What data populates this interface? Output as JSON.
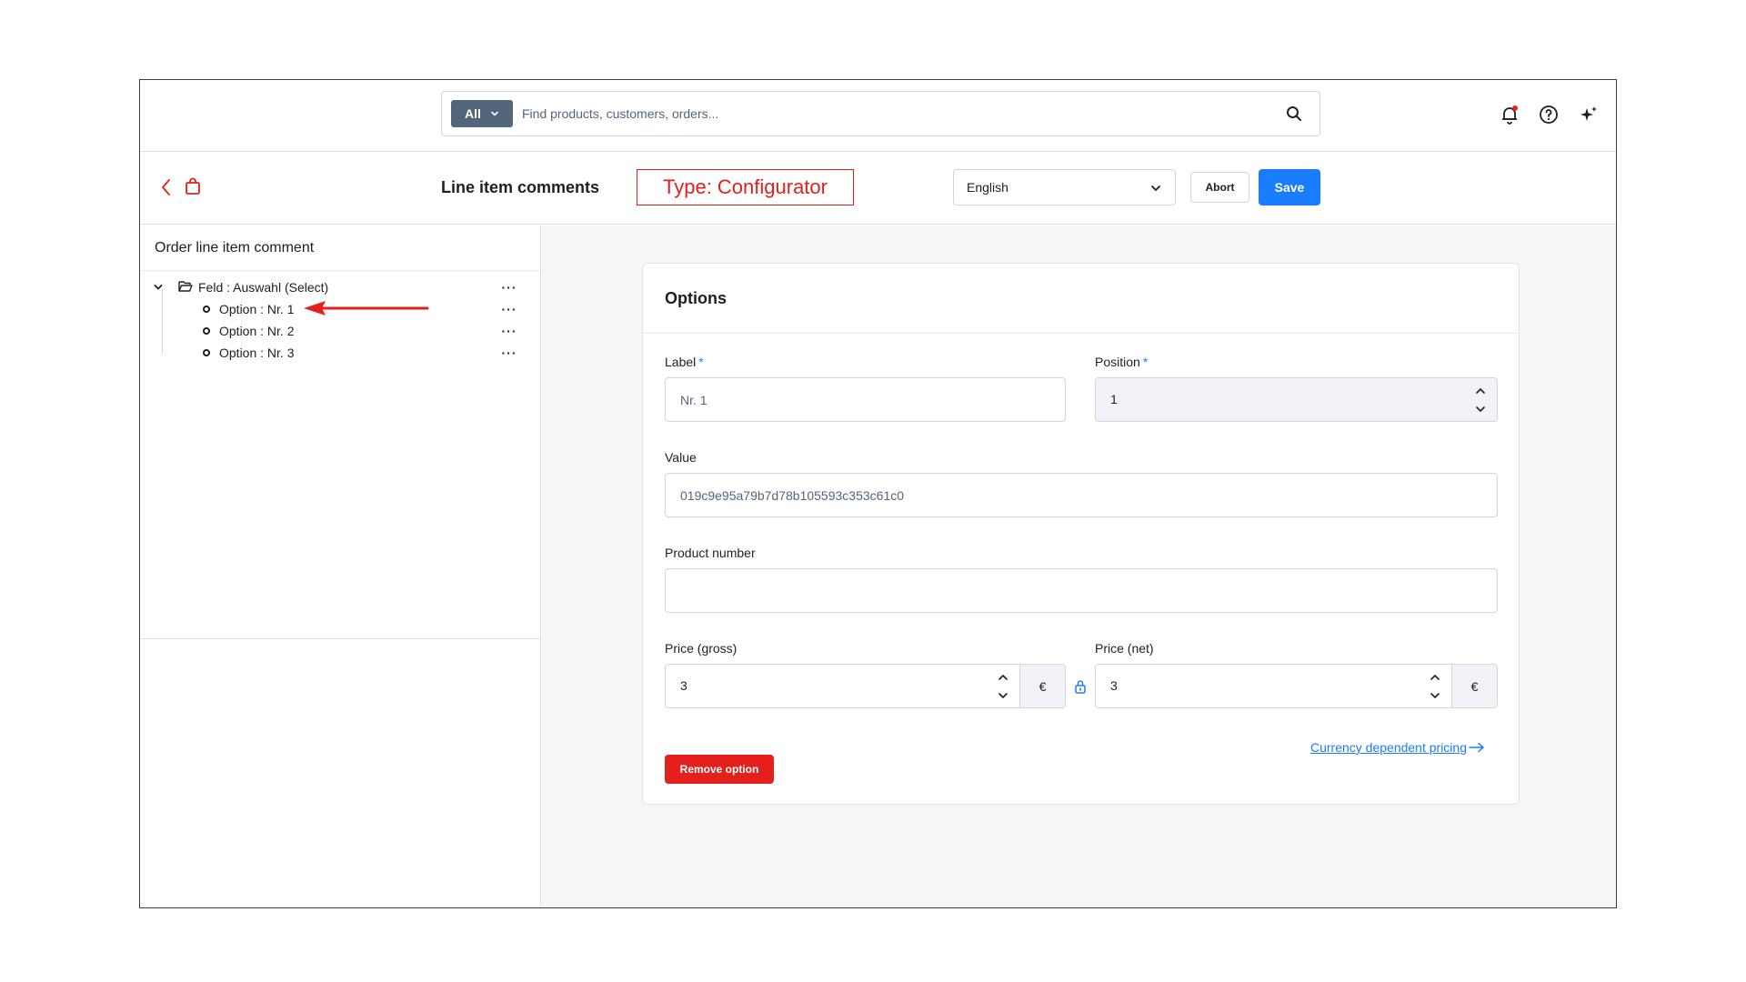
{
  "search": {
    "scope_label": "All",
    "placeholder": "Find products, customers, orders..."
  },
  "header": {
    "title": "Line item comments",
    "annotation": "Type: Configurator",
    "language": "English",
    "abort_label": "Abort",
    "save_label": "Save"
  },
  "sidebar": {
    "title": "Order line item comment",
    "tree": {
      "root": "Feld : Auswahl (Select)",
      "children": [
        "Option : Nr. 1",
        "Option : Nr. 2",
        "Option : Nr. 3"
      ]
    },
    "more_label": "···"
  },
  "options": {
    "title": "Options",
    "label_field": {
      "label": "Label",
      "required": "*",
      "value": "Nr. 1"
    },
    "position_field": {
      "label": "Position",
      "required": "*",
      "value": "1"
    },
    "value_field": {
      "label": "Value",
      "value": "019c9e95a79b7d78b105593c353c61c0"
    },
    "product_number_field": {
      "label": "Product number",
      "value": ""
    },
    "price_gross": {
      "label": "Price (gross)",
      "value": "3",
      "unit": "€"
    },
    "price_net": {
      "label": "Price (net)",
      "value": "3",
      "unit": "€"
    },
    "currency_link": "Currency dependent pricing",
    "remove_label": "Remove option"
  },
  "colors": {
    "primary": "#1a7cff",
    "danger": "#e3201b",
    "scope_bg": "#52667a"
  }
}
